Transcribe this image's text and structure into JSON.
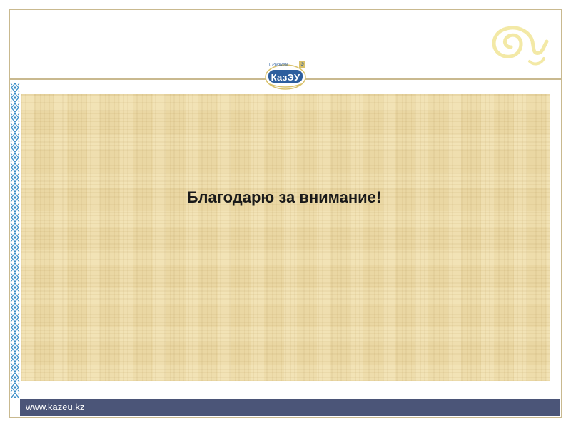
{
  "slide": {
    "message": "Благодарю за внимание!",
    "footer_url": "www.kazeu.kz",
    "logo": {
      "label": "КазЭУ",
      "tagline": "Т. Рыскулов",
      "corner": "Э"
    }
  },
  "colors": {
    "frame": "#c9b98f",
    "parchment": "#ead7a3",
    "footer": "#4b5578",
    "logo_blue": "#2d5e9e",
    "ornament_blue": "#3a8fc9",
    "swirl": "#f3e9a6"
  },
  "icons": {
    "swirl": "swirl-ornament-icon",
    "border": "kazakh-ornament-border"
  }
}
